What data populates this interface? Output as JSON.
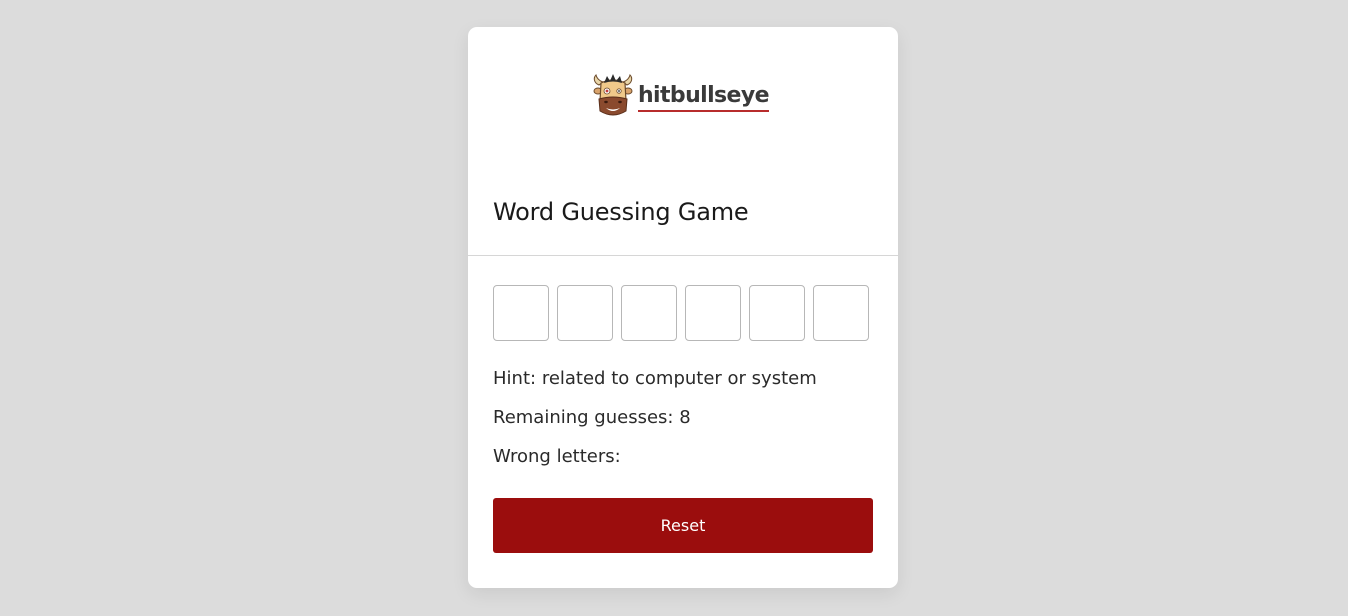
{
  "logo": {
    "text": "hitbullseye"
  },
  "game": {
    "title": "Word Guessing Game",
    "letters": [
      "",
      "",
      "",
      "",
      "",
      ""
    ],
    "hint_label": "Hint:",
    "hint_text": "related to computer or system",
    "remaining_label": "Remaining guesses:",
    "remaining_count": "8",
    "wrong_label": "Wrong letters:",
    "wrong_letters": "",
    "reset_label": "Reset"
  },
  "colors": {
    "background": "#dcdcdc",
    "card": "#ffffff",
    "accent": "#9b0d0d",
    "logo_underline": "#b82c2c"
  },
  "icons": {
    "logo_mascot": "bull-mascot-icon"
  }
}
